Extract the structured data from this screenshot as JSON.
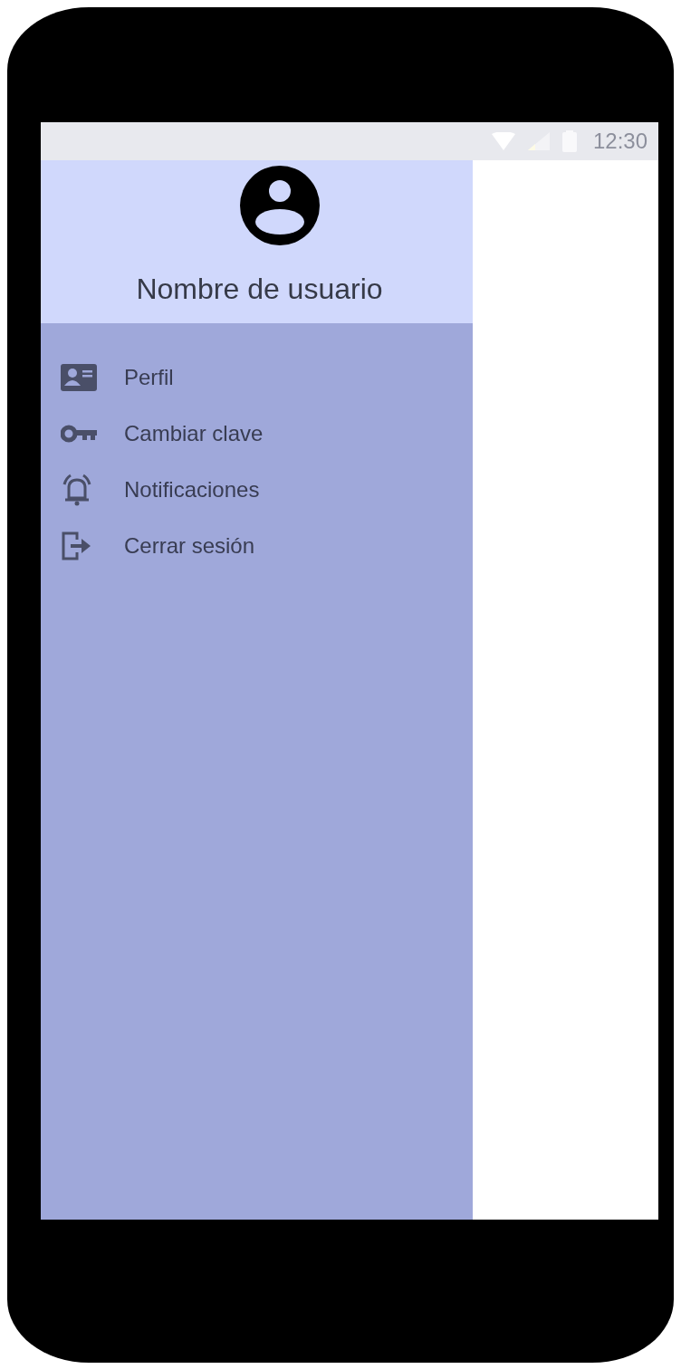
{
  "status_bar": {
    "time": "12:30"
  },
  "drawer": {
    "user_name": "Nombre de usuario",
    "items": [
      {
        "label": "Perfil"
      },
      {
        "label": "Cambiar clave"
      },
      {
        "label": "Notificaciones"
      },
      {
        "label": "Cerrar sesión"
      }
    ]
  }
}
